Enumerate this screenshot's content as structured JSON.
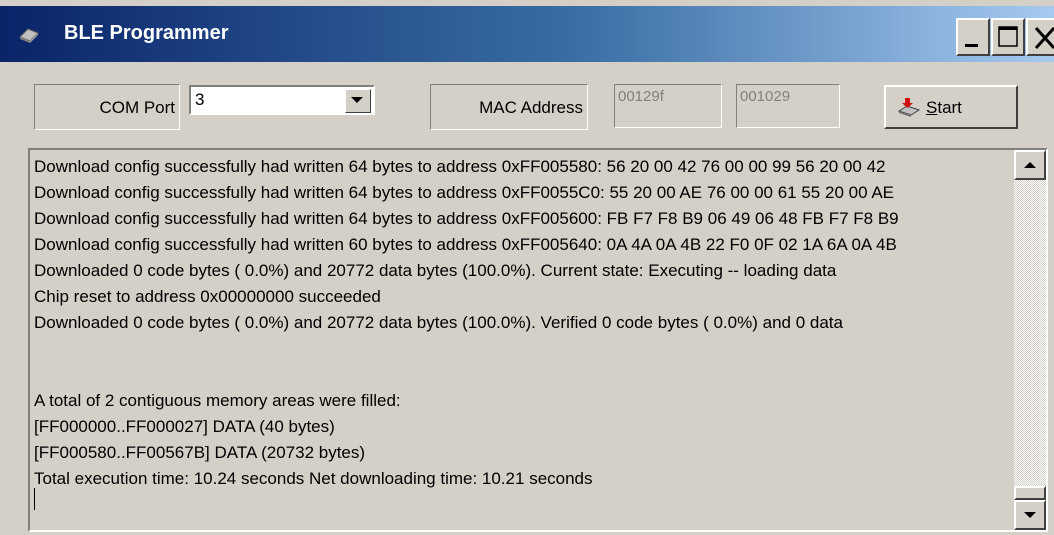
{
  "window": {
    "title": "BLE Programmer",
    "icon": "chip-icon"
  },
  "toolbar": {
    "com_port_label": "COM Port",
    "com_port_value": "3",
    "mac_address_label": "MAC Address",
    "mac_part1": "00129f",
    "mac_part2": "001029",
    "start_label_underlined": "S",
    "start_label_rest": "tart",
    "start_icon": "download-chip-icon"
  },
  "log": {
    "lines": [
      "Download config successfully had written 64 bytes to address 0xFF005580:  56 20 00 42 76 00 00 99 56 20 00 42",
      "Download config successfully had written 64 bytes to address 0xFF0055C0:  55 20 00 AE 76 00 00 61 55 20 00 AE",
      "Download config successfully had written 64 bytes to address 0xFF005600:  FB F7 F8 B9 06 49 06 48 FB F7 F8 B9",
      "Download config successfully had written 60 bytes to address 0xFF005640:  0A 4A 0A 4B 22 F0 0F 02 1A 6A 0A 4B",
      "Downloaded 0 code bytes ( 0.0%) and 20772 data bytes (100.0%).  Current state: Executing -- loading data",
      "Chip reset to address 0x00000000 succeeded",
      "Downloaded 0 code bytes ( 0.0%) and 20772 data bytes (100.0%). Verified 0 code bytes ( 0.0%) and 0 data",
      "",
      "",
      "A total of 2 contiguous memory areas were filled:",
      "[FF000000..FF000027] DATA (40 bytes)",
      "[FF000580..FF00567B] DATA (20732 bytes)",
      "Total execution time: 10.24 seconds     Net downloading time: 10.21 seconds"
    ]
  }
}
